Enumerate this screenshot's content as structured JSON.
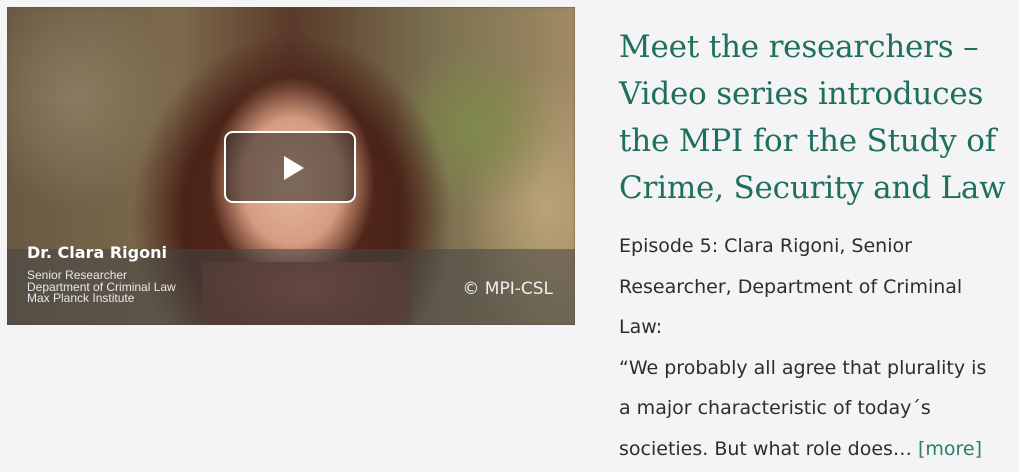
{
  "video": {
    "person_name": "Dr. Clara Rigoni",
    "subtitle_lines": [
      "Senior Researcher",
      "Department of Criminal Law",
      "Max Planck Institute"
    ],
    "copyright": "© MPI-CSL",
    "play_icon": "play-icon"
  },
  "article": {
    "headline_lines": [
      "Meet the researchers –",
      "Video series introduces",
      "the MPI for the Study of",
      "Crime, Security and Law"
    ],
    "body_lines": [
      "Episode 5: Clara Rigoni, Senior",
      "Researcher, Department of Criminal",
      "Law:",
      "“We probably all agree that plurality is",
      "a major characteristic of today´s",
      "societies. But what role does…"
    ],
    "more_link": "[more]"
  },
  "colors": {
    "headline": "#1f6f61",
    "link": "#2a7d6f",
    "background": "#f4f4f4"
  }
}
